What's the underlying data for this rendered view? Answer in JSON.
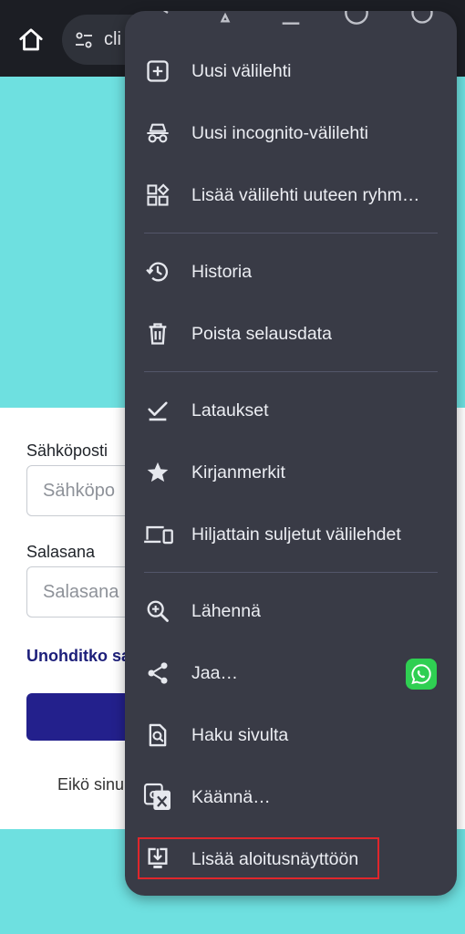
{
  "browser": {
    "url_text": "cli"
  },
  "page": {
    "email_label": "Sähköposti",
    "email_placeholder": "Sähköpo",
    "password_label": "Salasana",
    "password_placeholder": "Salasana",
    "forgot_link": "Unohditko sa",
    "signup_text": "Eikö sinu"
  },
  "menu": {
    "items": [
      {
        "label": "Uusi välilehti",
        "icon": "add-box-icon"
      },
      {
        "label": "Uusi incognito-välilehti",
        "icon": "incognito-icon"
      },
      {
        "label": "Lisää välilehti uuteen ryhm…",
        "icon": "tab-group-icon"
      },
      {
        "label": "Historia",
        "icon": "history-icon"
      },
      {
        "label": "Poista selausdata",
        "icon": "trash-icon"
      },
      {
        "label": "Lataukset",
        "icon": "download-check-icon"
      },
      {
        "label": "Kirjanmerkit",
        "icon": "star-icon"
      },
      {
        "label": "Hiljattain suljetut välilehdet",
        "icon": "devices-icon"
      },
      {
        "label": "Lähennä",
        "icon": "zoom-in-icon"
      },
      {
        "label": "Jaa…",
        "icon": "share-icon"
      },
      {
        "label": "Haku sivulta",
        "icon": "find-in-page-icon"
      },
      {
        "label": "Käännä…",
        "icon": "translate-icon"
      },
      {
        "label": "Lisää aloitusnäyttöön",
        "icon": "add-to-home-icon"
      }
    ],
    "highlighted_item": "Lisää aloitusnäyttöön"
  },
  "colors": {
    "accent_highlight": "#e0262b",
    "menu_bg": "#393b46",
    "page_bg": "#6ee0e0",
    "button_bg": "#23208c",
    "whatsapp": "#2fcf52"
  }
}
